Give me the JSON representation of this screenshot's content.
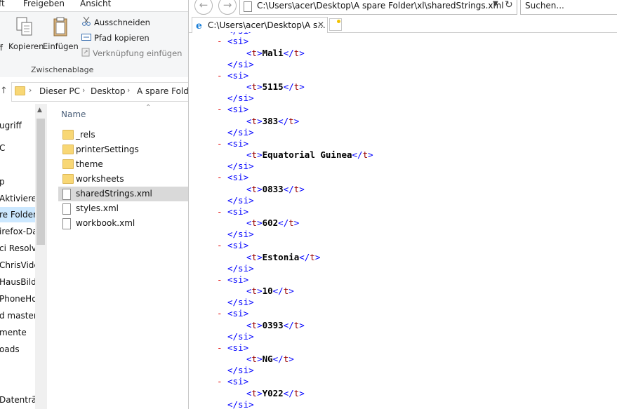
{
  "explorer": {
    "ribbon_tabs": [
      "ft",
      "Freigeben",
      "Ansicht"
    ],
    "ribbon": {
      "copy_label": "Kopieren",
      "paste_label": "Einfügen",
      "cut_label": "Ausschneiden",
      "copy_path_label": "Pfad kopieren",
      "paste_shortcut_label": "Verknüpfung einfügen",
      "left_cut_label": "ff",
      "group_label": "Zwischenablage"
    },
    "breadcrumb": [
      "Dieser PC",
      "Desktop",
      "A spare Folde"
    ],
    "nav_items": [
      "ugriff",
      "C",
      "",
      "p",
      "Aktivierer",
      "re Folder",
      "irefox-Da",
      "ci Resolve",
      "ChrisVideo",
      "HausBilde",
      "PhoneHo",
      "d masterL",
      "mente",
      "oads",
      "",
      "Datenträ"
    ],
    "column_header": "Name",
    "files": [
      {
        "name": "_rels",
        "type": "folder"
      },
      {
        "name": "printerSettings",
        "type": "folder"
      },
      {
        "name": "theme",
        "type": "folder"
      },
      {
        "name": "worksheets",
        "type": "folder"
      },
      {
        "name": "sharedStrings.xml",
        "type": "file"
      },
      {
        "name": "styles.xml",
        "type": "file"
      },
      {
        "name": "workbook.xml",
        "type": "file"
      }
    ]
  },
  "browser": {
    "url": "C:\\Users\\acer\\Desktop\\A spare Folder\\xl\\sharedStrings.xml",
    "search_placeholder": "Suchen...",
    "tab_title": "C:\\Users\\acer\\Desktop\\A s...",
    "xml_values": [
      "Mali",
      "5115",
      "383",
      "Equatorial Guinea",
      "0833",
      "602",
      "Estonia",
      "10",
      "0393",
      "NG",
      "Y022"
    ],
    "si_open": "<si>",
    "si_close": "</si>",
    "t_open": "t",
    "minus": "-"
  },
  "colors": {
    "tag": "#0000ff",
    "tag_name": "#990000",
    "collapse": "#e00000",
    "selection": "#cce8ff"
  }
}
